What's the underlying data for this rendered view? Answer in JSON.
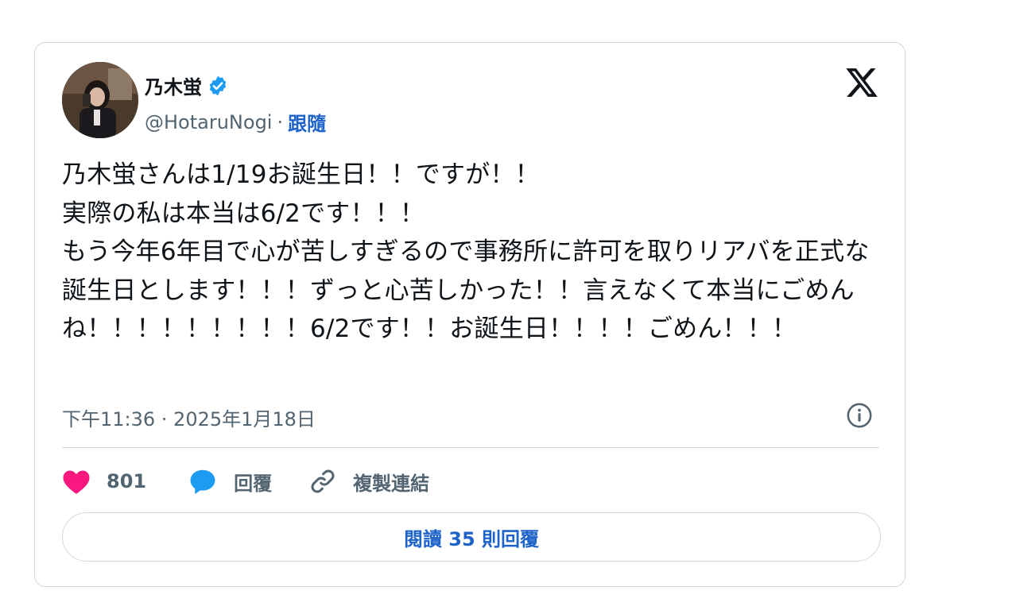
{
  "author": {
    "display_name": "乃木蛍",
    "handle": "@HotaruNogi",
    "separator": "·",
    "follow_label": "跟隨",
    "verified": true
  },
  "tweet": {
    "text": "乃木蛍さんは1/19お誕生日！！ですが！！\n実際の私は本当は6/2です！！！\nもう今年6年目で心が苦しすぎるので事務所に許可を取りリアバを正式な誕生日とします！！！ずっと心苦しかった！！言えなくて本当にごめんね！！！！！！！！！6/2です！！お誕生日！！！！ごめん！！！",
    "timestamp": "下午11:36 · 2025年1月18日"
  },
  "actions": {
    "like_count": "801",
    "reply_label": "回覆",
    "copy_link_label": "複製連結"
  },
  "read_replies_label": "閱讀 35 則回覆",
  "colors": {
    "accent": "#1d63c9",
    "like": "#f91880",
    "reply": "#1d9bf0",
    "verified": "#1d9bf0",
    "muted": "#536471",
    "border": "#cfd9de"
  },
  "icons": {
    "verified": "verified-badge-icon",
    "logo": "x-logo-icon",
    "info": "info-icon",
    "like": "heart-icon",
    "reply": "speech-bubble-icon",
    "link": "link-icon"
  }
}
